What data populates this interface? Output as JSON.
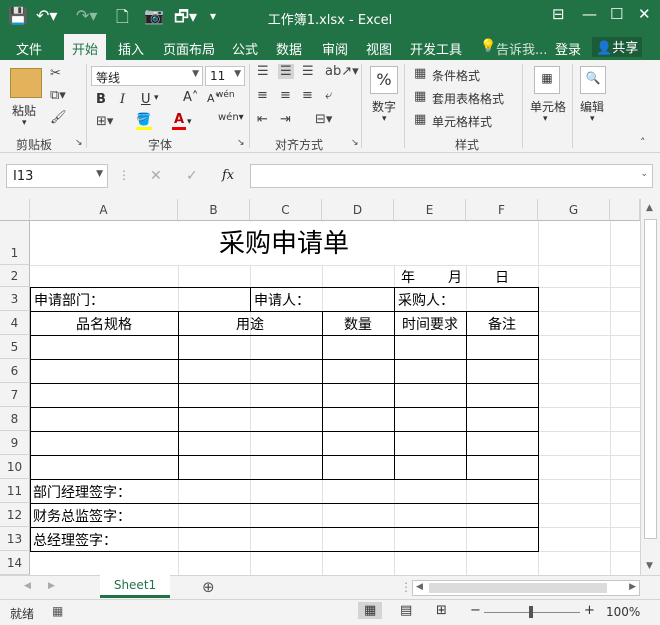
{
  "window": {
    "title": "工作簿1.xlsx - Excel"
  },
  "ribbon_tabs": [
    "文件",
    "开始",
    "插入",
    "页面布局",
    "公式",
    "数据",
    "审阅",
    "视图",
    "开发工具"
  ],
  "tell_me": "告诉我...",
  "login": "登录",
  "share": "共享",
  "ribbon": {
    "paste": "粘贴",
    "font_name": "等线",
    "font_size": "11",
    "bold": "B",
    "italic": "I",
    "underline": "U",
    "number": "数字",
    "cond_format": "条件格式",
    "table_format": "套用表格格式",
    "cell_style": "单元格样式",
    "cells": "单元格",
    "editing": "编辑",
    "groups": {
      "clipboard": "剪贴板",
      "font": "字体",
      "alignment": "对齐方式",
      "styles": "样式"
    }
  },
  "namebox": "I13",
  "fx": "fx",
  "columns": [
    "A",
    "B",
    "C",
    "D",
    "E",
    "F",
    "G"
  ],
  "rows": [
    "1",
    "2",
    "3",
    "4",
    "5",
    "6",
    "7",
    "8",
    "9",
    "10",
    "11",
    "12",
    "13",
    "14"
  ],
  "sheet": {
    "title": "采购申请单",
    "date_year": "年",
    "date_month": "月",
    "date_day": "日",
    "dept": "申请部门：",
    "applicant": "申请人：",
    "buyer": "采购人：",
    "headers": [
      "品名规格",
      "用途",
      "数量",
      "时间要求",
      "备注"
    ],
    "sign_dept": "部门经理签字：",
    "sign_finance": "财务总监签字：",
    "sign_gm": "总经理签字："
  },
  "sheet_tab": "Sheet1",
  "status": {
    "ready": "就绪",
    "zoom": "100%"
  },
  "colors": {
    "excel_green": "#217346"
  }
}
